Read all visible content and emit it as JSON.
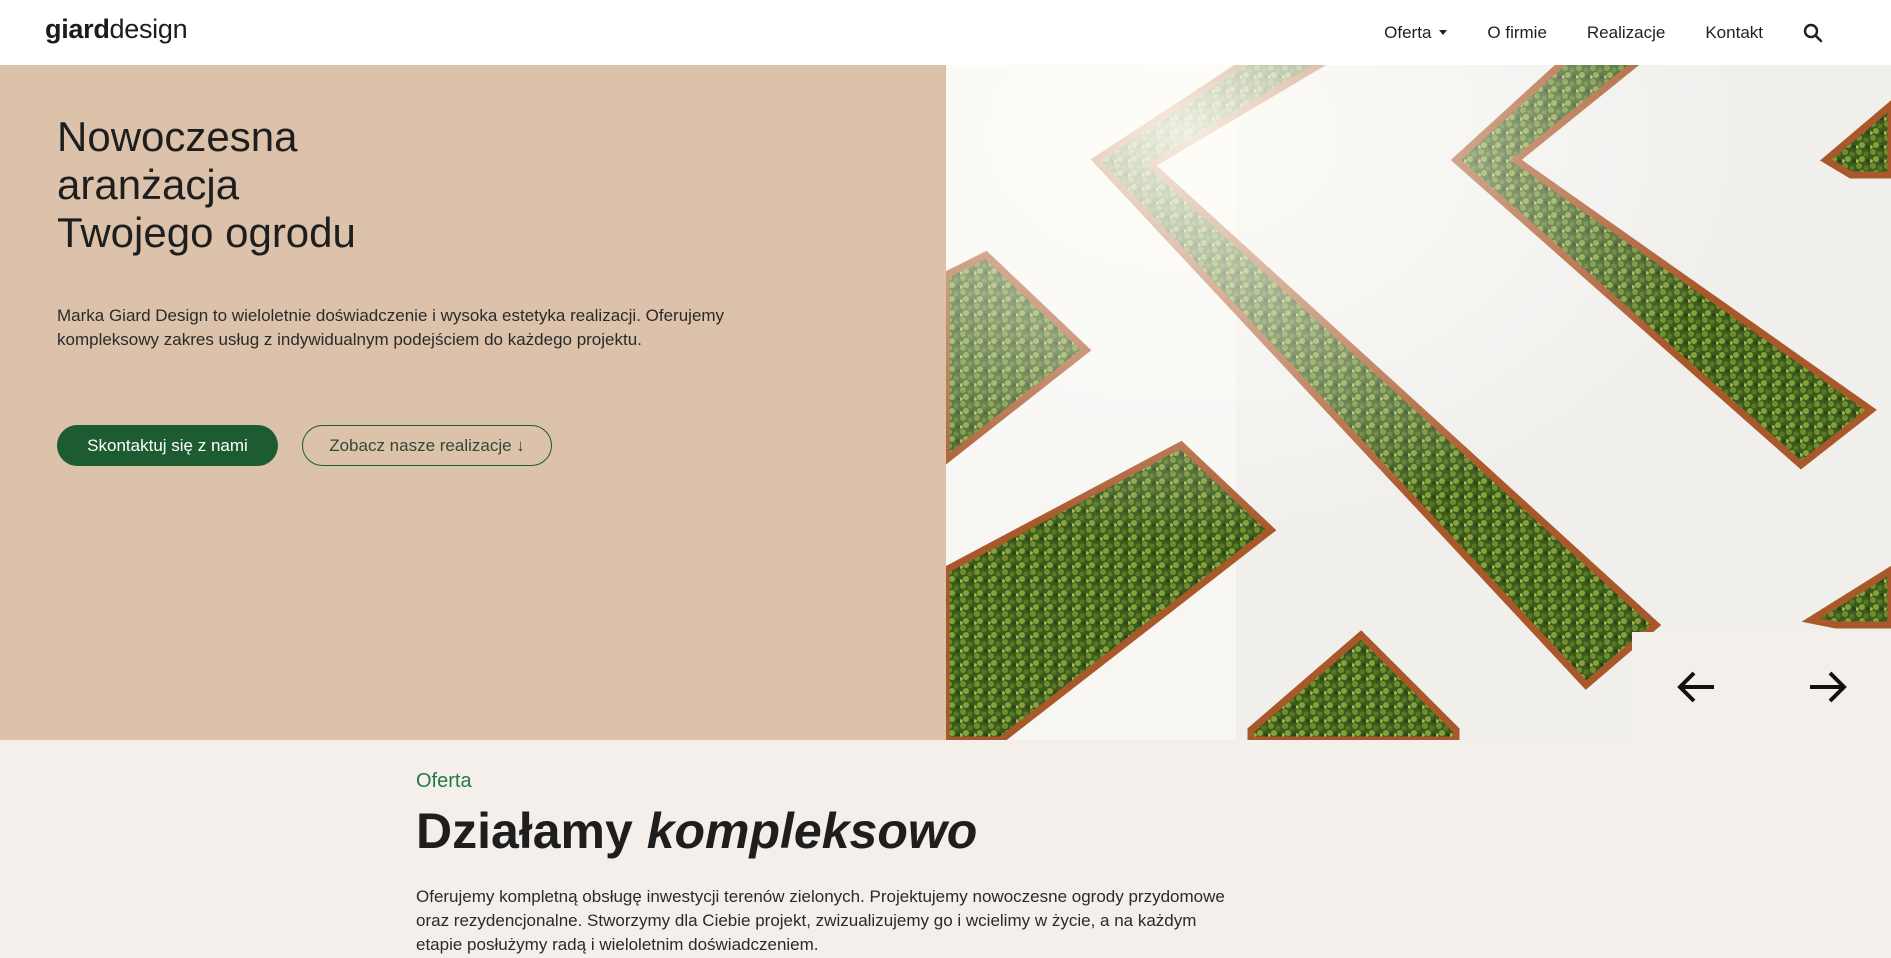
{
  "brand": {
    "bold": "giard",
    "light": "design"
  },
  "nav": {
    "items": [
      {
        "label": "Oferta",
        "has_dropdown": true
      },
      {
        "label": "O firmie"
      },
      {
        "label": "Realizacje"
      },
      {
        "label": "Kontakt"
      }
    ],
    "search_icon": "search-icon"
  },
  "hero": {
    "title_lines": [
      "Nowoczesna",
      "aranżacja",
      "Twojego ogrodu"
    ],
    "description": "Marka Giard Design to wieloletnie doświadczenie i wysoka estetyka realizacji. Oferujemy kompleksowy zakres usług z indywidualnym podejściem do każdego projektu.",
    "primary_button": "Skontaktuj się z nami",
    "secondary_button": "Zobacz nasze realizacje ↓",
    "image_alt": "Vertical garden with green plant panels in copper frames",
    "slider": {
      "prev_icon": "arrow-left-icon",
      "next_icon": "arrow-right-icon"
    }
  },
  "offer_section": {
    "eyebrow": "Oferta",
    "title_plain": "Działamy",
    "title_italic": "kompleksowo",
    "text": "Oferujemy kompletną obsługę inwestycji terenów zielonych. Projektujemy nowoczesne ogrody przydomowe oraz rezydencjonalne. Stworzymy dla Ciebie projekt, zwizualizujemy go i wcielimy w życie, a na każdym etapie posłużymy radą i wieloletnim doświadczeniem."
  },
  "colors": {
    "hero_bg": "#dcc2ab",
    "section_bg": "#f4efea",
    "primary_green": "#1d5b31",
    "accent_green": "#237a45",
    "planter_copper": "#a9582a"
  }
}
